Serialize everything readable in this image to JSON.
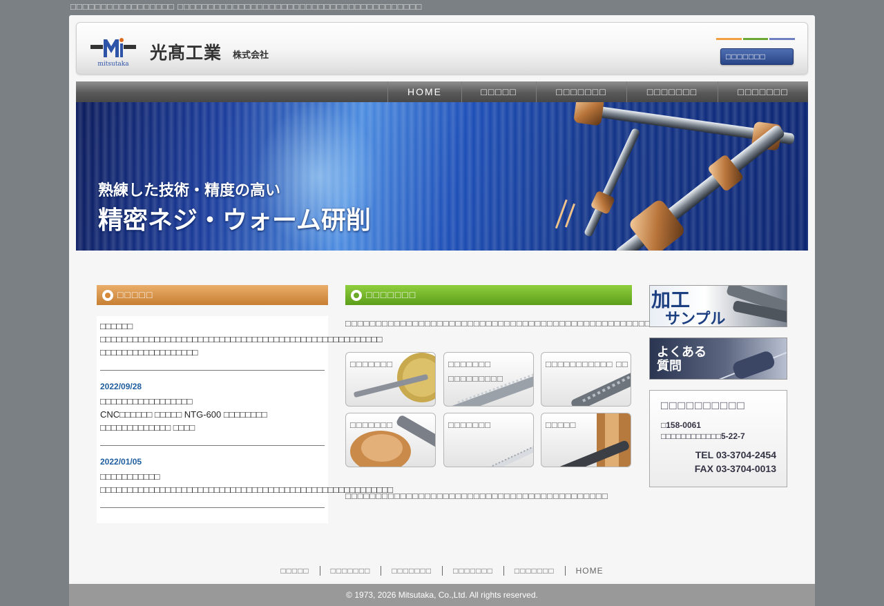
{
  "tagline": "□□□□□□□□□□□□□□□□□ □□□□□□□□□□□□□□□□□□□□□□□□□□□□□□□□□□□□□□□□",
  "header": {
    "logo_sub": "mitsutaka",
    "company_name": "光髙工業",
    "company_suffix": "株式会社",
    "contact_label": "□□□□□□□",
    "accent_colors": [
      "#f0a040",
      "#6aa832",
      "#6d7fc0"
    ]
  },
  "nav": {
    "items": [
      "HOME",
      "□□□□□",
      "□□□□□□□",
      "□□□□□□□",
      "□□□□□□□"
    ]
  },
  "hero": {
    "line1": "熟練した技術・精度の高い",
    "line2": "精密ネジ・ウォーム研削"
  },
  "news": {
    "title": "□□□□□",
    "items": [
      {
        "date": "",
        "title": "□□□□□□",
        "body": "□□□□□□□□□□□□□□□□□□□□□□□□□□□□□□□□□□□□□□□□□□□□□□□□□□□□ □□□□□□□□□□□□□□□□□□"
      },
      {
        "date": "2022/09/28",
        "title": "□□□□□□□□□□□□□□□□□",
        "body": "CNC□□□□□□ □□□□□ NTG-600 □□□□□□□□ □□□□□□□□□□□□□ □□□□"
      },
      {
        "date": "2022/01/05",
        "title": "□□□□□□□□□□□",
        "body": "□□□□□□□□□□□□□□□□□□□□□□□□□□□□□□□□□□□□□□□□□□□□□□□□□□□□□□"
      }
    ]
  },
  "business": {
    "title": "□□□□□□□",
    "intro": "□□□□□□□□□□□□□□□□□□□□□□□□□□□□□□□□□□□□□□□□□□□□□□□□□□□□□□□□□□□□□□□□□□",
    "tiles": [
      {
        "label": "□□□□□□□"
      },
      {
        "label": "□□□□□□□ □□□□□□□□□"
      },
      {
        "label": "□□□□□□□□□□□ □□"
      },
      {
        "label": "□□□□□□□"
      },
      {
        "label": "□□□□□□□"
      },
      {
        "label": "□□□□□"
      }
    ],
    "outro": "□□□□□□□□□□□□□□□□□□□□□□□□□□□□□□□□□□□□□□□□□□□"
  },
  "banners": {
    "sample": "加工サンプル",
    "faq": "よくある質問"
  },
  "address": {
    "title": "□□□□□□□□□□",
    "zip": "□158-0061",
    "line": "□□□□□□□□□□□□5-22-7",
    "tel": "TEL 03-3704-2454",
    "fax": "FAX 03-3704-0013"
  },
  "footer": {
    "links": [
      "□□□□□",
      "□□□□□□□",
      "□□□□□□□",
      "□□□□□□□",
      "□□□□□□□",
      "HOME"
    ],
    "copyright": "© 1973, 2026 Mitsutaka, Co.,Ltd. All rights reserved."
  }
}
